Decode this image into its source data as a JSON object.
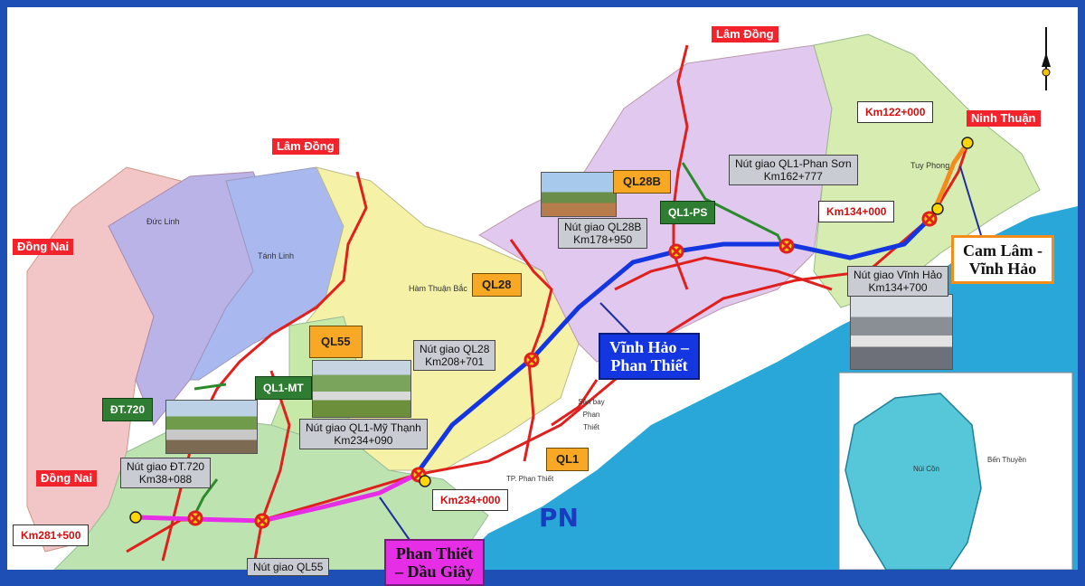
{
  "labels": {
    "lamdong_left": "Lâm Đồng",
    "lamdong_top": "Lâm Đồng",
    "dongnai_top": "Đồng Nai",
    "dongnai_bottom": "Đồng Nai",
    "ninhthuan": "Ninh Thuận",
    "km122": "Km122+000",
    "km134": "Km134+000",
    "km234": "Km234+000",
    "km281": "Km281+500",
    "ql28b": "QL28B",
    "ql28": "QL28",
    "ql55": "QL55",
    "ql1": "QL1",
    "ql1ps": "QL1-PS",
    "ql1mt": "QL1-MT",
    "dt720": "ĐT.720",
    "nut_phanson": "Nút giao QL1-Phan Sơn\nKm162+777",
    "nut_ql28b": "Nút giao QL28B\nKm178+950",
    "nut_vinhhao": "Nút giao Vĩnh Hảo\nKm134+700",
    "nut_ql28": "Nút giao QL28\nKm208+701",
    "nut_mythanh": "Nút giao QL1-Mỹ Thạnh\nKm234+090",
    "nut_dt720": "Nút giao ĐT.720\nKm38+088",
    "nut_ql55": "Nút giao QL55",
    "camlam": "Cam Lâm -\nVĩnh Hảo",
    "vinhhao": "Vĩnh Hảo –\nPhan Thiết",
    "phanthiet": "Phan Thiết\n– Dầu Giây",
    "logo_text": "PN"
  },
  "places": {
    "duc_linh": "Đức Linh",
    "tanh_linh": "Tánh Linh",
    "ham_thuan_bac": "Hàm Thuận Bắc",
    "tay_phong": "Tuy Phong",
    "phan_thiet": "TP. Phan Thiết",
    "san_bay": "Sân bay Phan Thiết",
    "ben_thuyen": "Bến Thuyền",
    "nui_con": "Núi Cồn"
  },
  "colors": {
    "sea": "#2aa7d9",
    "frame": "#1d4fb5",
    "expressway_blue": "#1436e0",
    "expressway_orange": "#f28c1a",
    "expressway_magenta": "#e62ee6",
    "road_red": "#e0201c",
    "road_green": "#2b8a2b"
  },
  "icons": {
    "north_arrow": "north-arrow-icon",
    "junction": "junction-x-icon"
  }
}
